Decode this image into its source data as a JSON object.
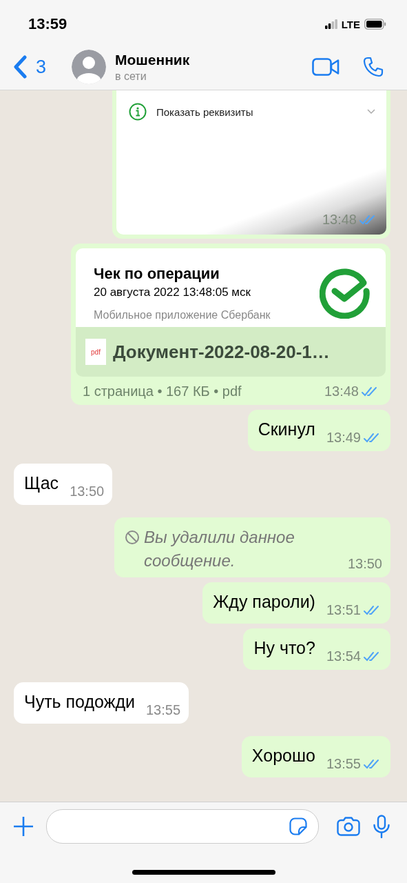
{
  "status_bar": {
    "time": "13:59",
    "network": "LTE"
  },
  "header": {
    "back_count": "3",
    "name": "Мошенник",
    "status": "в сети"
  },
  "messages": [
    {
      "kind": "receipt_screenshot",
      "outgoing": true,
      "link": "Показать реквизиты",
      "time": "13:48",
      "read": true
    },
    {
      "kind": "document",
      "outgoing": true,
      "preview_title": "Чек по операции",
      "preview_date": "20 августа 2022 13:48:05 мск",
      "preview_source": "Мобильное приложение Сбербанк",
      "file_type": "pdf",
      "file_name": "Документ-2022-08-20-1…",
      "meta": "1 страница • 167 КБ • pdf",
      "time": "13:48",
      "read": true
    },
    {
      "kind": "text",
      "outgoing": true,
      "text": "Скинул",
      "time": "13:49",
      "read": true
    },
    {
      "kind": "text",
      "outgoing": false,
      "text": "Щас",
      "time": "13:50"
    },
    {
      "kind": "deleted",
      "outgoing": true,
      "text": "Вы удалили данное сообщение.",
      "time": "13:50"
    },
    {
      "kind": "text",
      "outgoing": true,
      "text": "Жду пароли)",
      "time": "13:51",
      "read": true
    },
    {
      "kind": "text",
      "outgoing": true,
      "text": "Ну что?",
      "time": "13:54",
      "read": true
    },
    {
      "kind": "text",
      "outgoing": false,
      "text": "Чуть подожди",
      "time": "13:55"
    },
    {
      "kind": "text",
      "outgoing": true,
      "text": "Хорошо",
      "time": "13:55",
      "read": true
    }
  ]
}
